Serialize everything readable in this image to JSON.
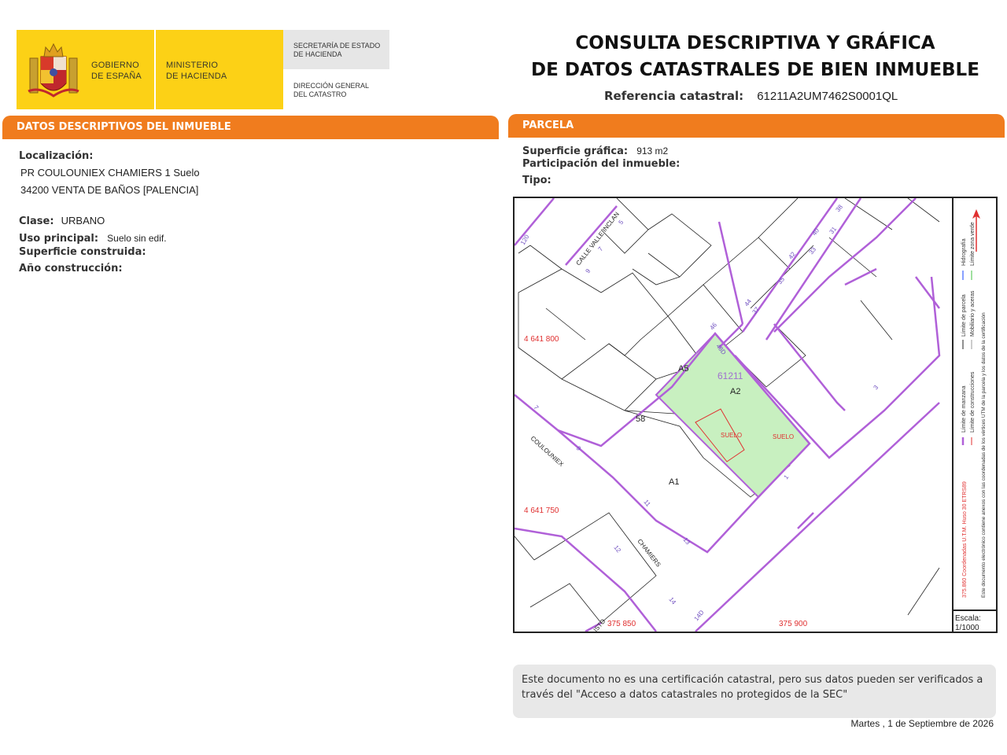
{
  "header": {
    "gov_line1": "GOBIERNO",
    "gov_line2": "DE ESPAÑA",
    "min_line1": "MINISTERIO",
    "min_line2": "DE HACIENDA",
    "sec_line1": "SECRETARÍA DE ESTADO",
    "sec_line2": "DE HACIENDA",
    "dir_line1": "DIRECCIÓN GENERAL",
    "dir_line2": "DEL CATASTRO",
    "title_line1": "CONSULTA DESCRIPTIVA Y GRÁFICA",
    "title_line2": "DE DATOS CATASTRALES DE BIEN INMUEBLE",
    "ref_label": "Referencia catastral:",
    "ref_value": "61211A2UM7462S0001QL"
  },
  "left_section": {
    "title": "DATOS DESCRIPTIVOS DEL INMUEBLE",
    "localizacion_label": "Localización:",
    "address_line1": "PR COULOUNIEX CHAMIERS 1 Suelo",
    "address_line2": "34200 VENTA DE BAÑOS [PALENCIA]",
    "clase_label": "Clase:",
    "clase_value": "URBANO",
    "uso_label": "Uso principal:",
    "uso_value": "Suelo sin edif.",
    "superficie_construida_label": "Superficie construida:",
    "anio_label": "Año construcción:"
  },
  "right_section": {
    "title": "PARCELA",
    "superficie_label": "Superficie gráfica:",
    "superficie_value": "913 m2",
    "participacion_label": "Participación del inmueble:",
    "tipo_label": "Tipo:"
  },
  "map": {
    "parcel_id": "61211",
    "labels": {
      "a5": "A5",
      "a2": "A2",
      "a1": "A1",
      "n58": "58",
      "suelo1": "SUELO",
      "suelo2": "SUELO",
      "street_valle": "CALLE VALLE INCLAN",
      "street_coul": "COULOUNIEX",
      "street_cham": "CHAMIERS",
      "street_isto": "ISTO"
    },
    "numbers": [
      "120",
      "5",
      "7",
      "9",
      "38",
      "40",
      "42",
      "44",
      "46",
      "48D",
      "31",
      "33",
      "35",
      "37",
      "3",
      "7",
      "9",
      "11",
      "13",
      "12",
      "14",
      "14D",
      "1",
      "1",
      "3"
    ],
    "coords": {
      "y1": "4 641 800",
      "y2": "4 641 750",
      "x1": "375 850",
      "x2": "375 900"
    },
    "scale_label": "Escala:",
    "scale_value": "1/1000"
  },
  "legend": {
    "item_manzana": "Límite de manzana",
    "item_parcela": "Límite de parcela",
    "item_hidro": "Hidrografía",
    "item_constr": "Límite de construcciones",
    "item_mobil": "Mobiliario y aceras",
    "item_verde": "Límite zona verde",
    "coords_note": "375.860 Coordenadas U.T.M. Huso 30 ETRS89",
    "cert_note": "Este documento electrónico contiene anexos con las coordenadas de los vértices UTM de la parcela y los datos de la certificación"
  },
  "footer": {
    "note": "Este documento no es una certificación catastral, pero sus datos pueden ser verificados a través del \"Acceso a datos catastrales no protegidos de la SEC\"",
    "date": "Martes , 1 de Septiembre de 2026"
  },
  "colors": {
    "accent": "#f07c1e",
    "logo_yellow": "#FCD116",
    "parcel_fill": "#c8f0c0",
    "block_line": "#b060d8",
    "red": "#e03030"
  }
}
